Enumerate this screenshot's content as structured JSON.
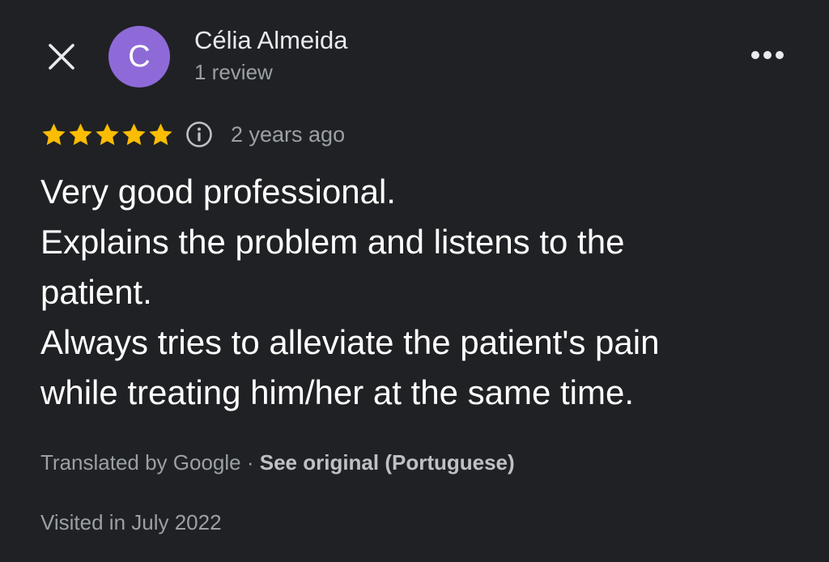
{
  "header": {
    "close_icon": "close-icon",
    "avatar_letter": "C",
    "avatar_color": "#8e6ad8",
    "author_name": "Célia Almeida",
    "review_count": "1 review",
    "more_icon": "more-horizontal-icon"
  },
  "rating": {
    "stars": 5,
    "max_stars": 5,
    "star_color": "#fbbc04",
    "info_icon": "info-icon",
    "time_ago": "2 years ago"
  },
  "review": {
    "lines": [
      "Very good professional.",
      "Explains the problem and listens to the",
      "patient.",
      "Always tries to alleviate the patient's pain",
      "while treating him/her at the same time."
    ]
  },
  "translation": {
    "prefix": "Translated by Google",
    "separator": " · ",
    "see_original": "See original (Portuguese)"
  },
  "visited": "Visited in July 2022",
  "colors": {
    "background": "#202124",
    "primary_text": "#ffffff",
    "secondary_text": "#9aa0a6"
  }
}
